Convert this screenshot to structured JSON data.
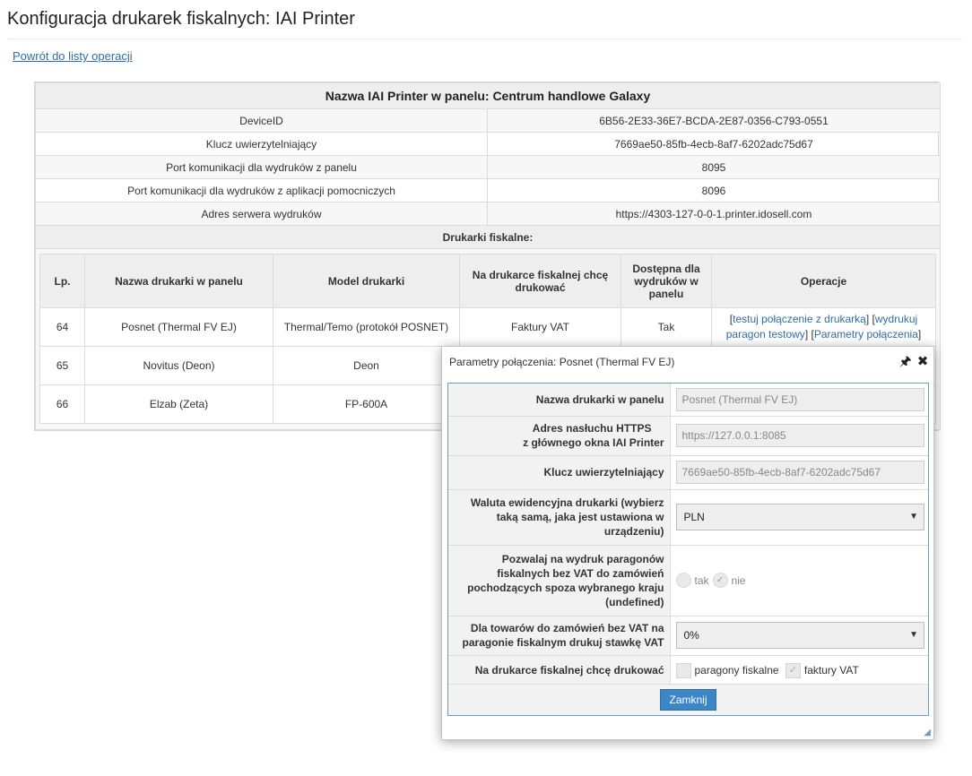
{
  "page": {
    "title": "Konfiguracja drukarek fiskalnych: IAI Printer",
    "back_link": "Powrót do listy operacji"
  },
  "info": {
    "header": "Nazwa IAI Printer w panelu: Centrum handlowe Galaxy",
    "rows": [
      {
        "label": "DeviceID",
        "value": "6B56-2E33-36E7-BCDA-2E87-0356-C793-0551"
      },
      {
        "label": "Klucz uwierzytelniający",
        "value": "7669ae50-85fb-4ecb-8af7-6202adc75d67"
      },
      {
        "label": "Port komunikacji dla wydruków z panelu",
        "value": "8095"
      },
      {
        "label": "Port komunikacji dla wydruków z aplikacji pomocniczych",
        "value": "8096"
      },
      {
        "label": "Adres serwera wydruków",
        "value": "https://4303-127-0-0-1.printer.idosell.com"
      }
    ],
    "subheader": "Drukarki fiskalne:"
  },
  "printers": {
    "headers": [
      "Lp.",
      "Nazwa drukarki w panelu",
      "Model drukarki",
      "Na drukarce fiskalnej chcę drukować",
      "Dostępna dla wydruków w panelu",
      "Operacje"
    ],
    "rows": [
      {
        "lp": "64",
        "name": "Posnet (Thermal FV EJ)",
        "model": "Thermal/Temo (protokół POSNET)",
        "print": "Faktury VAT",
        "available": "Tak"
      },
      {
        "lp": "65",
        "name": "Novitus (Deon)",
        "model": "Deon",
        "print": "",
        "available": ""
      },
      {
        "lp": "66",
        "name": "Elzab (Zeta)",
        "model": "FP-600A",
        "print": "",
        "available": ""
      }
    ],
    "ops": {
      "test": "testuj połączenie z drukarką",
      "print_test": "wydrukuj paragon testowy",
      "params": "Parametry połączenia"
    }
  },
  "dialog": {
    "title": "Parametry połączenia: Posnet (Thermal FV EJ)",
    "fields": {
      "name_label": "Nazwa drukarki w panelu",
      "name_value": "Posnet (Thermal FV EJ)",
      "https_label_1": "Adres nasłuchu HTTPS",
      "https_label_2": "z głównego okna IAI Printer",
      "https_value": "https://127.0.0.1:8085",
      "key_label": "Klucz uwierzytelniający",
      "key_value": "7669ae50-85fb-4ecb-8af7-6202adc75d67",
      "currency_label": "Waluta ewidencyjna drukarki (wybierz taką samą, jaka jest ustawiona w urządzeniu)",
      "currency_value": "PLN",
      "novat_label": "Pozwalaj na wydruk paragonów fiskalnych bez VAT do zamówień pochodzących spoza wybranego kraju (undefined)",
      "novat_yes": "tak",
      "novat_no": "nie",
      "rate_label": "Dla towarów do zamówień bez VAT na paragonie fiskalnym drukuj stawkę VAT",
      "rate_value": "0%",
      "print_label": "Na drukarce fiskalnej chcę drukować",
      "print_receipts": "paragony fiskalne",
      "print_invoices": "faktury VAT"
    },
    "close_button": "Zamknij"
  }
}
